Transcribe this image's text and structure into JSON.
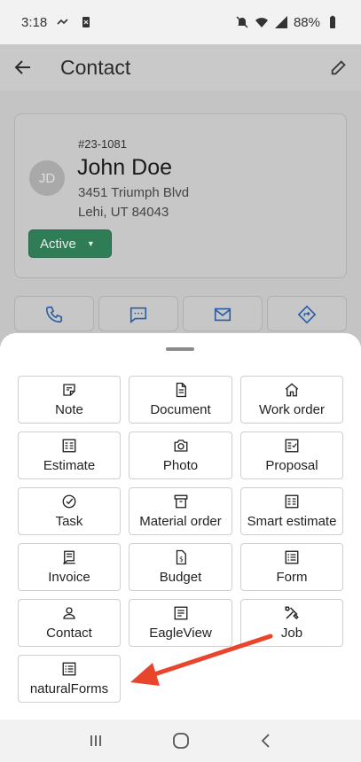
{
  "status_bar": {
    "time": "3:18",
    "battery": "88%"
  },
  "app_bar": {
    "title": "Contact"
  },
  "contact": {
    "job_number": "#23-1081",
    "initials": "JD",
    "name": "John Doe",
    "address_line1": "3451 Triumph Blvd",
    "address_line2": "Lehi, UT 84043",
    "status": "Active"
  },
  "sheet": {
    "items": [
      {
        "label": "Note",
        "icon": "note-icon"
      },
      {
        "label": "Document",
        "icon": "document-icon"
      },
      {
        "label": "Work order",
        "icon": "home-icon"
      },
      {
        "label": "Estimate",
        "icon": "estimate-icon"
      },
      {
        "label": "Photo",
        "icon": "camera-icon"
      },
      {
        "label": "Proposal",
        "icon": "proposal-icon"
      },
      {
        "label": "Task",
        "icon": "check-circle-icon"
      },
      {
        "label": "Material order",
        "icon": "archive-icon"
      },
      {
        "label": "Smart estimate",
        "icon": "smart-estimate-icon"
      },
      {
        "label": "Invoice",
        "icon": "invoice-icon"
      },
      {
        "label": "Budget",
        "icon": "budget-icon"
      },
      {
        "label": "Form",
        "icon": "list-icon"
      },
      {
        "label": "Contact",
        "icon": "person-icon"
      },
      {
        "label": "EagleView",
        "icon": "eagleview-icon"
      },
      {
        "label": "Job",
        "icon": "tools-icon"
      },
      {
        "label": "naturalForms",
        "icon": "list-icon"
      }
    ]
  },
  "colors": {
    "status_active": "#2e7d57",
    "annotation_arrow": "#e8452c"
  }
}
